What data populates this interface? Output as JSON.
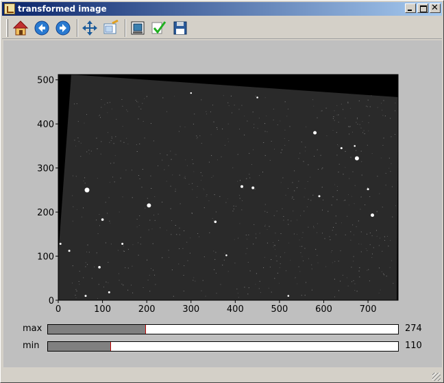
{
  "window": {
    "title": "transformed image"
  },
  "toolbar": {
    "tools": [
      {
        "name": "home-icon"
      },
      {
        "name": "back-arrow-icon"
      },
      {
        "name": "forward-arrow-icon"
      },
      {
        "name": "pan-move-icon"
      },
      {
        "name": "zoom-rect-icon"
      },
      {
        "name": "subplot-config-icon"
      },
      {
        "name": "checkmark-icon"
      },
      {
        "name": "save-floppy-icon"
      }
    ]
  },
  "plot": {
    "x_ticks": [
      "0",
      "100",
      "200",
      "300",
      "400",
      "500",
      "600",
      "700"
    ],
    "y_ticks": [
      "0",
      "100",
      "200",
      "300",
      "400",
      "500"
    ],
    "x_range": [
      0,
      768
    ],
    "y_range": [
      0,
      512
    ],
    "colors": {
      "background": "#000000",
      "sky": "#2a2a2a"
    }
  },
  "sliders": {
    "max": {
      "label": "max",
      "value": "274",
      "fill_fraction": 0.28
    },
    "min": {
      "label": "min",
      "value": "110",
      "fill_fraction": 0.18
    }
  }
}
